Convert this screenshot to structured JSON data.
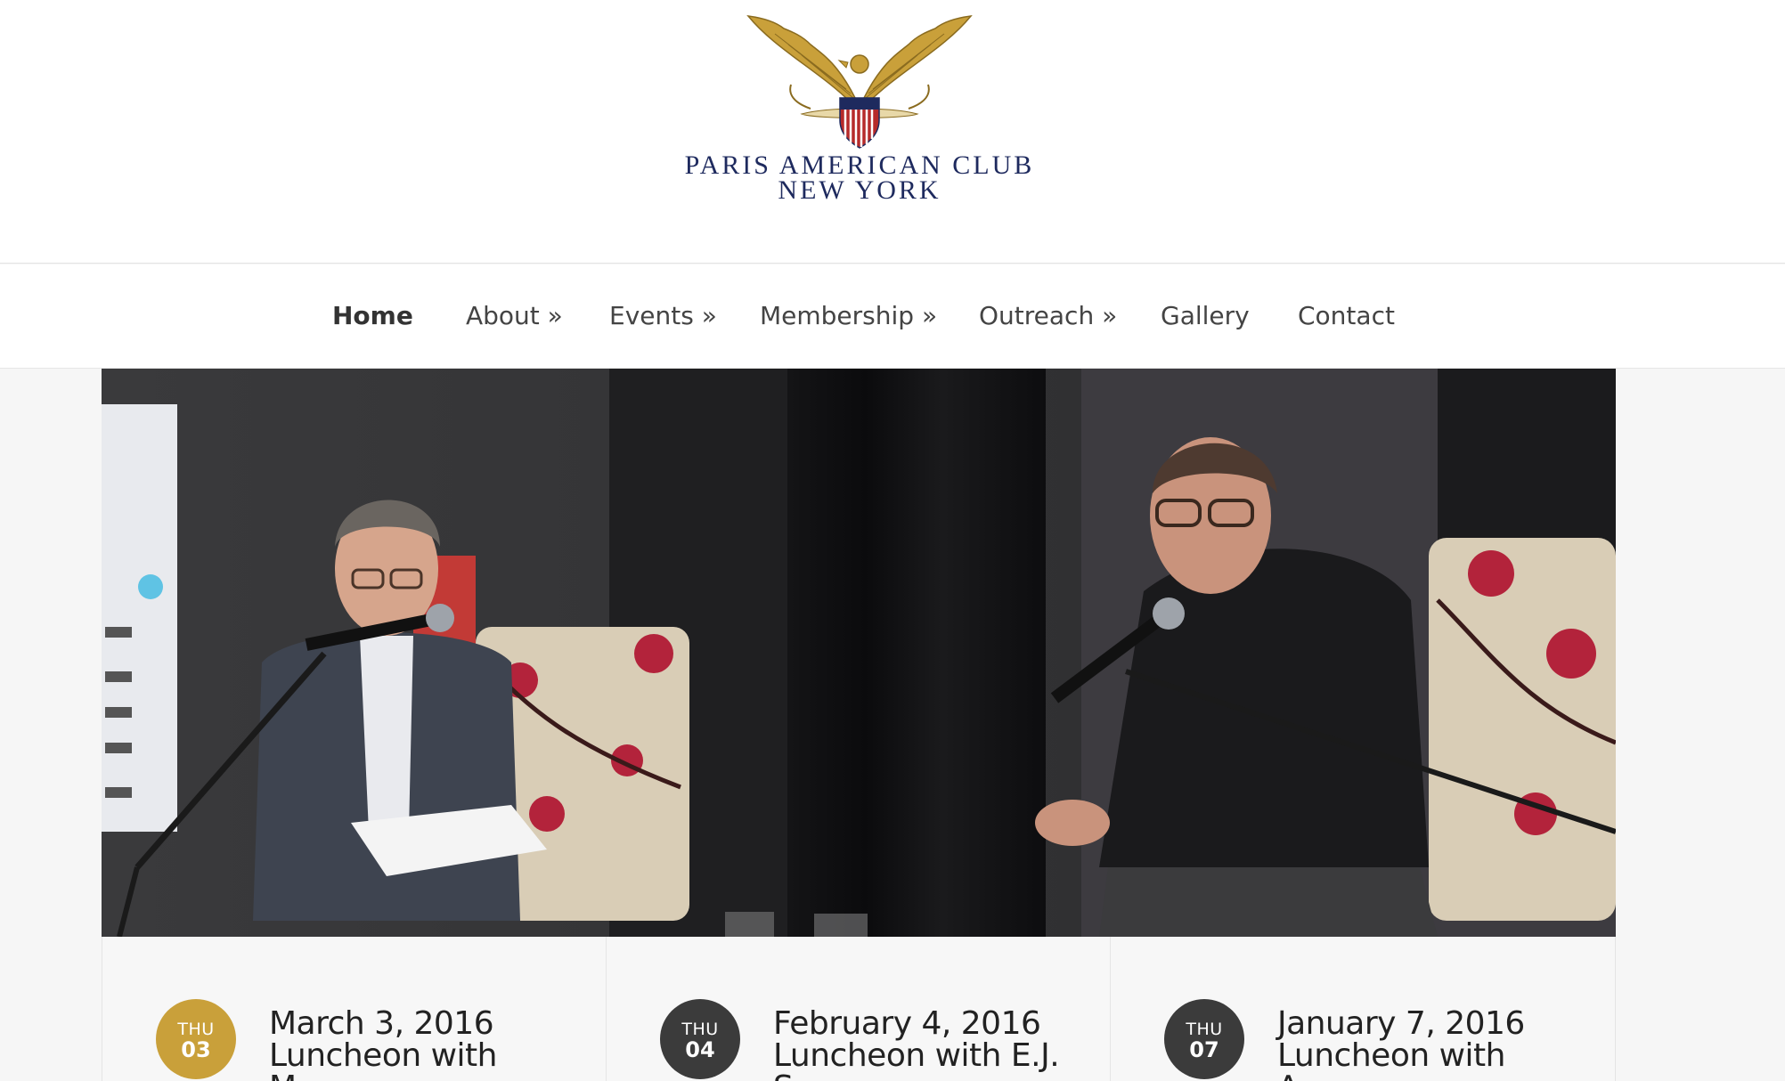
{
  "site": {
    "logo_line1": "Paris American Club",
    "logo_line2": "New York"
  },
  "nav": {
    "items": [
      {
        "label": "Home",
        "active": true
      },
      {
        "label": "About »"
      },
      {
        "label": "Events »"
      },
      {
        "label": "Membership »"
      },
      {
        "label": "Outreach »"
      },
      {
        "label": "Gallery"
      },
      {
        "label": "Contact"
      }
    ]
  },
  "events": [
    {
      "dow": "THU",
      "day": "03",
      "date": "March 3, 2016",
      "title_line": "Luncheon with",
      "title_cut": "M",
      "badge_color": "#c9a03a"
    },
    {
      "dow": "THU",
      "day": "04",
      "date": "February 4, 2016",
      "title_line": "Luncheon with E.J.",
      "title_cut": "S",
      "badge_color": "#3b3b3b"
    },
    {
      "dow": "THU",
      "day": "07",
      "date": "January 7, 2016",
      "title_line": "Luncheon with",
      "title_cut": "A",
      "badge_color": "#3b3b3b"
    }
  ],
  "colors": {
    "gold": "#c9a03a",
    "navy": "#1e2a5e",
    "dark_badge": "#3b3b3b"
  }
}
